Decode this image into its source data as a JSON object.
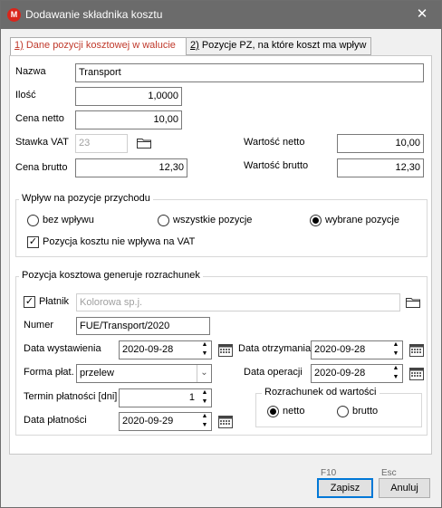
{
  "window": {
    "title": "Dodawanie składnika kosztu",
    "app_icon_letter": "M"
  },
  "tabs": [
    {
      "num": "1)",
      "label": " Dane pozycji kosztowej w walucie"
    },
    {
      "num": "2)",
      "label": " Pozycje PZ, na które koszt ma wpływ"
    }
  ],
  "form": {
    "nazwa_label": "Nazwa",
    "nazwa_value": "Transport",
    "ilosc_label": "Ilość",
    "ilosc_value": "1,0000",
    "cena_netto_label": "Cena netto",
    "cena_netto_value": "10,00",
    "stawka_vat_label": "Stawka VAT",
    "stawka_vat_value": "23",
    "cena_brutto_label": "Cena brutto",
    "cena_brutto_value": "12,30",
    "wartosc_netto_label": "Wartość netto",
    "wartosc_netto_value": "10,00",
    "wartosc_brutto_label": "Wartość brutto",
    "wartosc_brutto_value": "12,30"
  },
  "wplyw_group": {
    "title": "Wpływ na pozycje przychodu",
    "options": [
      "bez wpływu",
      "wszystkie pozycje",
      "wybrane pozycje"
    ],
    "selected_index": 2,
    "vat_checkbox_label": "Pozycja kosztu nie wpływa na VAT",
    "vat_checkbox_checked": true
  },
  "rozrachunek_group": {
    "title": "Pozycja kosztowa generuje rozrachunek",
    "platnik_label": "Płatnik",
    "platnik_checked": true,
    "platnik_value": "Kolorowa sp.j.",
    "numer_label": "Numer",
    "numer_value": "FUE/Transport/2020",
    "data_wystawienia_label": "Data wystawienia",
    "data_wystawienia_value": "2020-09-28",
    "data_otrzymania_label": "Data otrzymania",
    "data_otrzymania_value": "2020-09-28",
    "forma_plat_label": "Forma płat.",
    "forma_plat_value": "przelew",
    "data_operacji_label": "Data operacji",
    "data_operacji_value": "2020-09-28",
    "termin_label": "Termin płatności [dni]",
    "termin_value": "1",
    "data_platnosci_label": "Data płatności",
    "data_platnosci_value": "2020-09-29",
    "od_wartosci": {
      "title": "Rozrachunek od wartości",
      "options": [
        "netto",
        "brutto"
      ],
      "selected_index": 0
    }
  },
  "footer": {
    "save_key": "F10",
    "save_label": "Zapisz",
    "cancel_key": "Esc",
    "cancel_label": "Anuluj"
  }
}
